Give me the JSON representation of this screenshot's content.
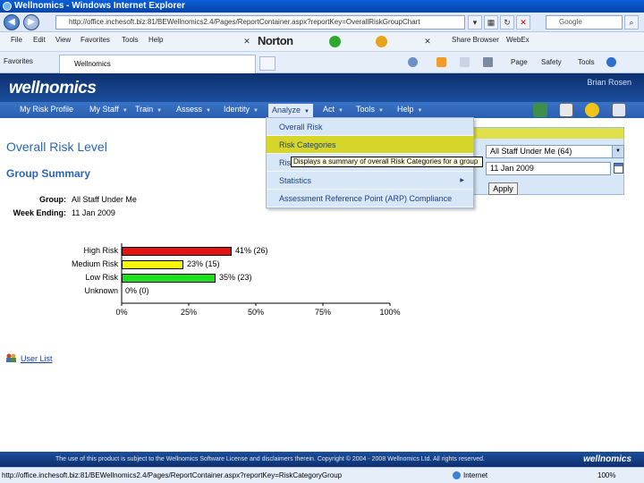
{
  "browser": {
    "window_title": "Wellnomics - Windows Internet Explorer",
    "address_url": "http://office.inchesoft.biz:81/BEWellnomics2.4/Pages/ReportContainer.aspx?reportKey=OverallRiskGroupChart",
    "search_placeholder": "Google",
    "menu": [
      "File",
      "Edit",
      "View",
      "Favorites",
      "Tools",
      "Help"
    ],
    "toolbar": {
      "norton": "Norton",
      "share": "Share Browser",
      "webex": "WebEx"
    },
    "favorites_label": "Favorites",
    "tab_title": "Wellnomics",
    "commands": [
      "Page",
      "Safety",
      "Tools"
    ],
    "status_url": "http://office.inchesoft.biz:81/BEWellnomics2.4/Pages/ReportContainer.aspx?reportKey=RiskCategoryGroup",
    "zone": "Internet",
    "zoom": "100%"
  },
  "app": {
    "logo": "wellnomics",
    "user_name": "Brian Rosen",
    "nav": [
      {
        "label": "My Risk Profile"
      },
      {
        "label": "My Staff"
      },
      {
        "label": "Train"
      },
      {
        "label": "Assess"
      },
      {
        "label": "Identity"
      },
      {
        "label": "Analyze"
      },
      {
        "label": "Act"
      },
      {
        "label": "Tools"
      },
      {
        "label": "Help"
      }
    ]
  },
  "dropdown": {
    "items": [
      "Overall Risk",
      "Risk Categories",
      "Risk",
      "Statistics",
      "Assessment Reference Point (ARP) Compliance"
    ],
    "tooltip": "Displays a summary of overall Risk Categories for a group"
  },
  "filter": {
    "group_value": "All Staff Under Me (64)",
    "date_value": "11 Jan 2009",
    "apply_label": "Apply"
  },
  "page": {
    "title": "Overall Risk Level",
    "section": "Group Summary",
    "group_label": "Group:",
    "group_value": "All Staff Under Me",
    "week_label": "Week Ending:",
    "week_value": "11 Jan 2009",
    "user_list_link": "User List"
  },
  "chart_data": {
    "type": "bar",
    "orientation": "horizontal",
    "categories": [
      "High Risk",
      "Medium Risk",
      "Low Risk",
      "Unknown"
    ],
    "values": [
      41,
      23,
      35,
      0
    ],
    "labels": [
      "41% (26)",
      "23% (15)",
      "35% (23)",
      "0% (0)"
    ],
    "colors": [
      "#e41313",
      "#f5f50a",
      "#1fe01f",
      "#cccccc"
    ],
    "xlim": [
      0,
      100
    ],
    "xticks": [
      "0%",
      "25%",
      "50%",
      "75%",
      "100%"
    ]
  },
  "footer": {
    "text": "The use of this product is subject to the Wellnomics Software License and disclaimers therein. Copyright © 2004 - 2008 Wellnomics Ltd. All rights reserved.",
    "logo": "wellnomics"
  }
}
